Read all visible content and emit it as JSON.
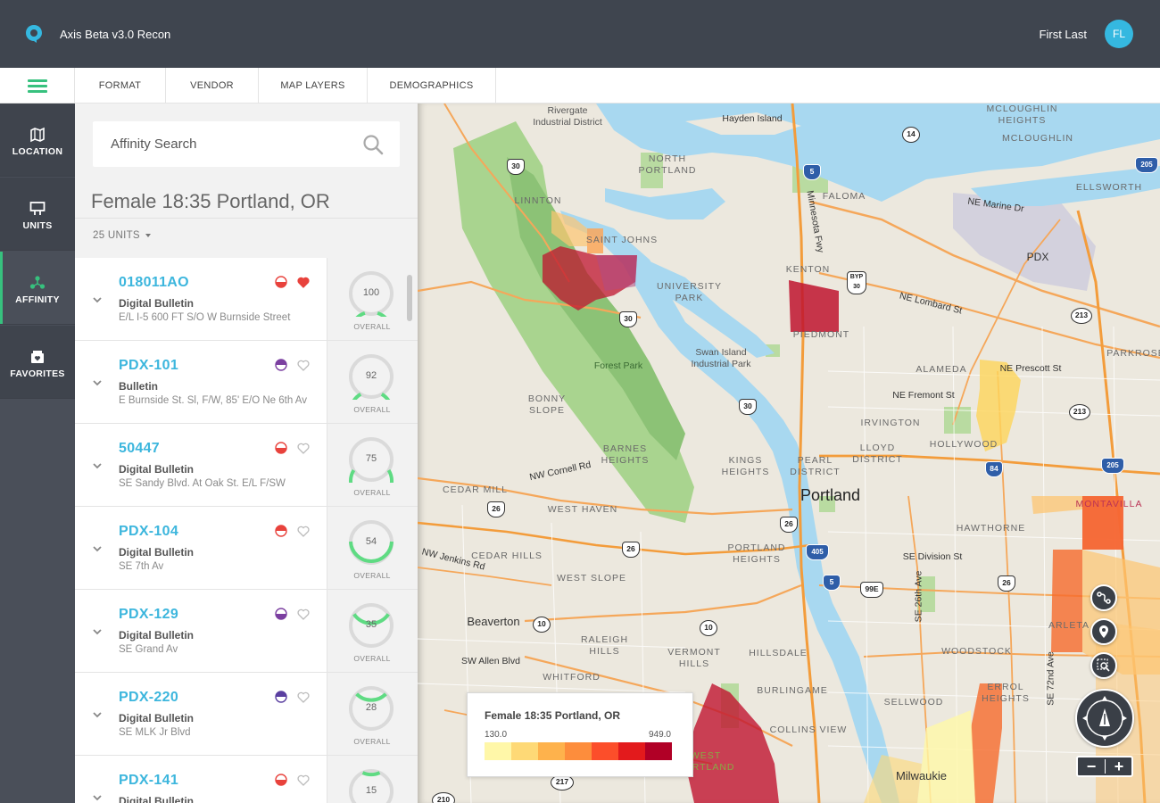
{
  "header": {
    "app_title": "Axis Beta v3.0 Recon",
    "user_name": "First Last",
    "user_initials": "FL"
  },
  "menu": {
    "items": [
      {
        "label": "FORMAT"
      },
      {
        "label": "VENDOR"
      },
      {
        "label": "MAP LAYERS"
      },
      {
        "label": "DEMOGRAPHICS"
      }
    ]
  },
  "sidebar": {
    "items": [
      {
        "label": "LOCATION",
        "icon": "map-icon"
      },
      {
        "label": "UNITS",
        "icon": "billboard-icon"
      },
      {
        "label": "AFFINITY",
        "icon": "affinity-icon",
        "active": true
      },
      {
        "label": "FAVORITES",
        "icon": "favorites-icon"
      }
    ]
  },
  "search": {
    "placeholder": "Affinity Search"
  },
  "results": {
    "title": "Female 18:35 Portland, OR",
    "units_filter": "25 UNITS",
    "score_label": "OVERALL",
    "units": [
      {
        "id": "018011AO",
        "type": "Digital Bulletin",
        "location": "E/L I-5 600 FT S/O W Burnside Street",
        "score": 100,
        "type_color": "#e8423c",
        "favorite": true
      },
      {
        "id": "PDX-101",
        "type": "Bulletin",
        "location": "E Burnside St. Sl, F/W, 85' E/O Ne 6th Av",
        "score": 92,
        "type_color": "#7b3fa0",
        "favorite": false
      },
      {
        "id": "50447",
        "type": "Digital Bulletin",
        "location": "SE Sandy Blvd. At Oak St. E/L F/SW",
        "score": 75,
        "type_color": "#e8423c",
        "favorite": false
      },
      {
        "id": "PDX-104",
        "type": "Digital Bulletin",
        "location": "SE 7th Av",
        "score": 54,
        "type_color": "#e8423c",
        "favorite": false
      },
      {
        "id": "PDX-129",
        "type": "Digital Bulletin",
        "location": "SE Grand Av",
        "score": 35,
        "type_color": "#7b3fa0",
        "favorite": false
      },
      {
        "id": "PDX-220",
        "type": "Digital Bulletin",
        "location": "SE MLK Jr Blvd",
        "score": 28,
        "type_color": "#5a3fa0",
        "favorite": false
      },
      {
        "id": "PDX-141",
        "type": "Digital Bulletin",
        "location": "",
        "score": 15,
        "type_color": "#e8423c",
        "favorite": false
      }
    ]
  },
  "map": {
    "labels": {
      "rivergate": "Rivergate\nIndustrial District",
      "hayden_island": "Hayden Island",
      "mcloughlin_heights": "MCLOUGHLIN\nHEIGHTS",
      "mcloughlin": "MCLOUGHLIN",
      "north_portland": "NORTH\nPORTLAND",
      "ellsworth": "ELLSWORTH",
      "faloma": "FALOMA",
      "linnton": "LINNTON",
      "ne_marine_dr": "NE Marine Dr",
      "pdx": "PDX",
      "saint_johns": "SAINT JOHNS",
      "minnesota_fwy": "Minnesota Fwy",
      "kenton": "KENTON",
      "university_park": "UNIVERSITY\nPARK",
      "ne_lombard": "NE Lombard St",
      "parkrose": "PARKROSE",
      "piedmont": "PIEDMONT",
      "swan_island": "Swan Island\nIndustrial Park",
      "forest_park": "Forest Park",
      "alameda": "ALAMEDA",
      "ne_prescott": "NE Prescott St",
      "bonny_slope": "BONNY\nSLOPE",
      "ne_fremont": "NE Fremont St",
      "irvington": "IRVINGTON",
      "hollywood": "HOLLYWOOD",
      "lloyd_district": "LLOYD\nDISTRICT",
      "barnes_heights": "BARNES\nHEIGHTS",
      "kings_heights": "KINGS\nHEIGHTS",
      "pearl_district": "PEARL\nDISTRICT",
      "nw_cornell": "NW Cornell Rd",
      "cedar_mill": "CEDAR MILL",
      "portland": "Portland",
      "montavilla": "MONTAVILLA",
      "west_haven": "WEST HAVEN",
      "hawthorne": "HAWTHORNE",
      "portland_heights": "PORTLAND\nHEIGHTS",
      "se_division": "SE Division St",
      "cedar_hills": "CEDAR HILLS",
      "nw_jenkins": "NW Jenkins Rd",
      "west_slope": "WEST SLOPE",
      "se_26th": "SE 26th Ave",
      "beaverton": "Beaverton",
      "raleigh_hills": "RALEIGH\nHILLS",
      "arleta": "ARLETA",
      "sw_allen": "SW Allen Blvd",
      "vermont_hills": "VERMONT\nHILLS",
      "hillsdale": "HILLSDALE",
      "woodstock": "WOODSTOCK",
      "se_72nd": "SE 72nd Ave",
      "whitford": "WHITFORD",
      "burlingame": "BURLINGAME",
      "errol_heights": "ERROL\nHEIGHTS",
      "sellwood": "SELLWOOD",
      "collins_view": "COLLINS VIEW",
      "milwaukie": "Milwaukie",
      "west_portland": "WEST\nPORTLAND"
    },
    "shields": [
      "14",
      "30",
      "5",
      "205",
      "BYP 30",
      "30",
      "213",
      "30",
      "213",
      "84",
      "205",
      "26",
      "26",
      "405",
      "26",
      "26",
      "5",
      "99E",
      "10",
      "10",
      "217",
      "210"
    ],
    "legend": {
      "title": "Female 18:35 Portland, OR",
      "min": "130.0",
      "max": "949.0",
      "colors": [
        "#fff7a8",
        "#fed976",
        "#feb24c",
        "#fd8d3c",
        "#fc4e2a",
        "#e31a1c",
        "#b10026"
      ]
    }
  },
  "colors": {
    "accent": "#37c17e",
    "link": "#3cb6dd",
    "header_bg": "#3f454f"
  }
}
